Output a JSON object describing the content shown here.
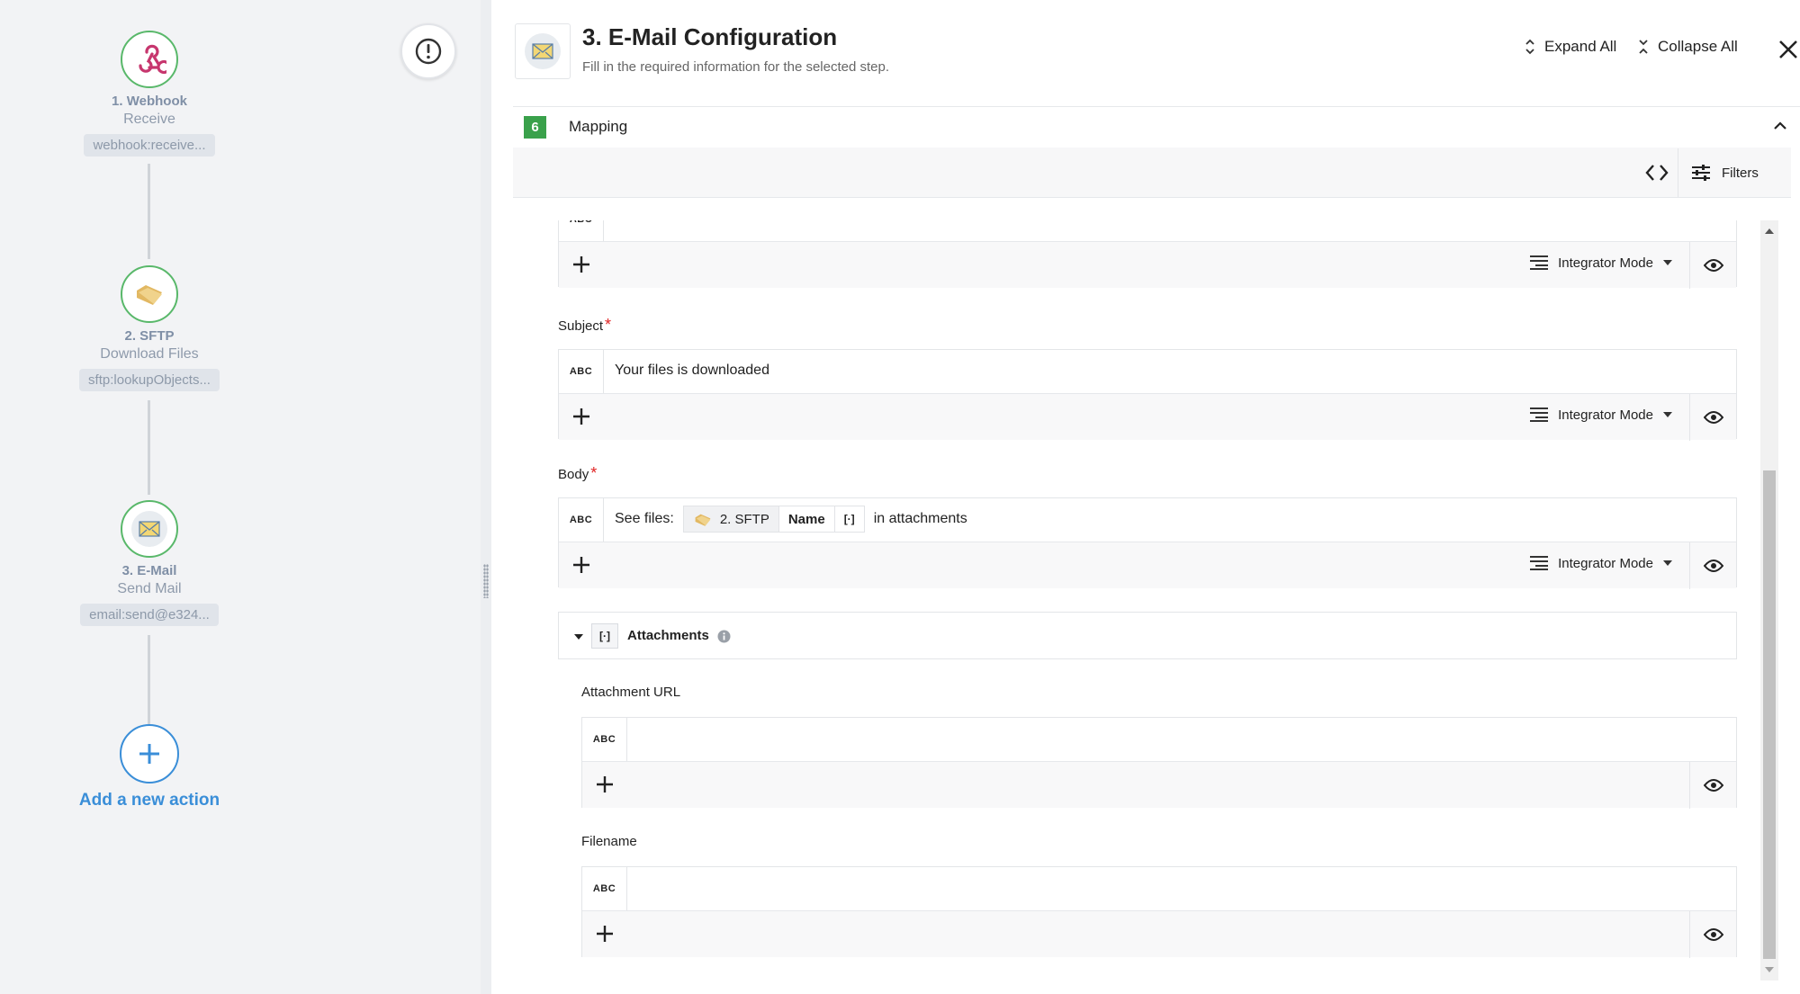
{
  "flow": {
    "nodes": [
      {
        "title": "1. Webhook",
        "subtitle": "Receive",
        "badge": "webhook:receive..."
      },
      {
        "title": "2. SFTP",
        "subtitle": "Download Files",
        "badge": "sftp:lookupObjects..."
      },
      {
        "title": "3. E-Mail",
        "subtitle": "Send Mail",
        "badge": "email:send@e324..."
      }
    ],
    "add_action": "Add a new action"
  },
  "header": {
    "title": "3. E-Mail Configuration",
    "subtitle": "Fill in the required information for the selected step.",
    "expand_all": "Expand All",
    "collapse_all": "Collapse All"
  },
  "section": {
    "number": "6",
    "title": "Mapping"
  },
  "toolbar": {
    "filters": "Filters"
  },
  "form": {
    "abc": "ABC",
    "mode": "Integrator Mode",
    "subject_label": "Subject",
    "subject_value": "Your files is downloaded",
    "body_label": "Body",
    "body_prefix": "See files:",
    "body_token_step": "2. SFTP",
    "body_token_field": "Name",
    "body_token_array": "[·]",
    "body_suffix": "in attachments",
    "required_mark": "*",
    "attachments_label": "Attachments",
    "attachments_array": "[·]",
    "attachment_url_label": "Attachment URL",
    "filename_label": "Filename"
  }
}
